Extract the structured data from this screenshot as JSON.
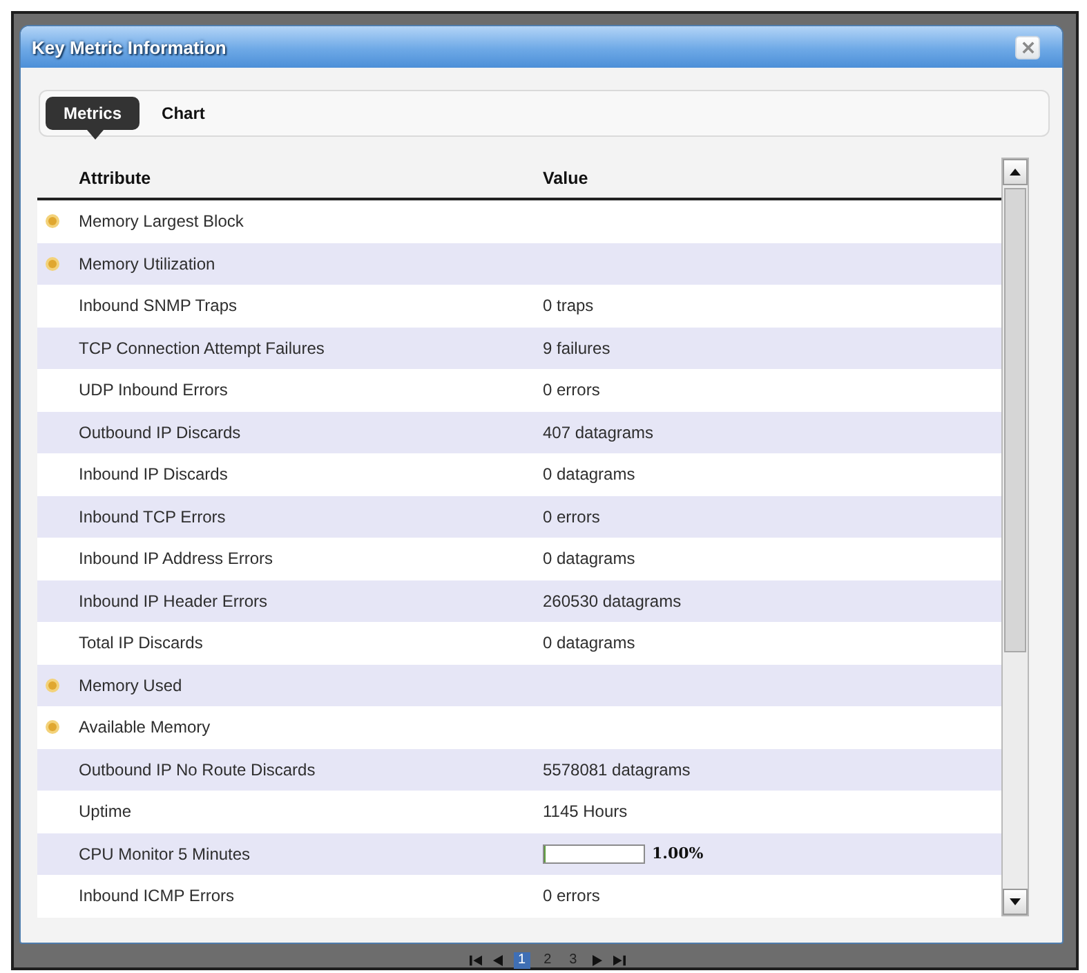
{
  "window": {
    "title": "Key Metric Information"
  },
  "tabs": [
    {
      "label": "Metrics",
      "selected": true
    },
    {
      "label": "Chart",
      "selected": false
    }
  ],
  "table": {
    "columns": [
      "Attribute",
      "Value"
    ],
    "rows": [
      {
        "kind": "text",
        "flagged": true,
        "attribute": "Memory Largest Block"
      },
      {
        "kind": "text",
        "flagged": true,
        "attribute": "Memory Utilization"
      },
      {
        "kind": "text",
        "flagged": false,
        "attribute": "Inbound SNMP Traps",
        "value": "0 traps"
      },
      {
        "kind": "text",
        "flagged": false,
        "attribute": "TCP Connection Attempt Failures",
        "value": "9 failures"
      },
      {
        "kind": "text",
        "flagged": false,
        "attribute": "UDP Inbound Errors",
        "value": "0 errors"
      },
      {
        "kind": "text",
        "flagged": false,
        "attribute": "Outbound IP Discards",
        "value": "407 datagrams"
      },
      {
        "kind": "text",
        "flagged": false,
        "attribute": "Inbound IP Discards",
        "value": "0 datagrams"
      },
      {
        "kind": "text",
        "flagged": false,
        "attribute": "Inbound TCP Errors",
        "value": "0 errors"
      },
      {
        "kind": "text",
        "flagged": false,
        "attribute": "Inbound IP Address Errors",
        "value": "0 datagrams"
      },
      {
        "kind": "text",
        "flagged": false,
        "attribute": "Inbound IP Header Errors",
        "value": "260530 datagrams"
      },
      {
        "kind": "text",
        "flagged": false,
        "attribute": "Total IP Discards",
        "value": "0 datagrams"
      },
      {
        "kind": "text",
        "flagged": true,
        "attribute": "Memory Used"
      },
      {
        "kind": "text",
        "flagged": true,
        "attribute": "Available Memory"
      },
      {
        "kind": "text",
        "flagged": false,
        "attribute": "Outbound IP No Route Discards",
        "value": "5578081 datagrams"
      },
      {
        "kind": "text",
        "flagged": false,
        "attribute": "Uptime",
        "value": "1145 Hours"
      },
      {
        "kind": "meter",
        "flagged": false,
        "attribute": "CPU Monitor 5 Minutes",
        "level": 0.01,
        "value": "1.00%"
      },
      {
        "kind": "text",
        "flagged": false,
        "attribute": "Inbound ICMP Errors",
        "value": "0 errors"
      }
    ]
  },
  "pager": {
    "pages": [
      {
        "label": "1",
        "selected": true
      },
      {
        "label": "2",
        "selected": false
      },
      {
        "label": "3",
        "selected": false
      }
    ]
  }
}
